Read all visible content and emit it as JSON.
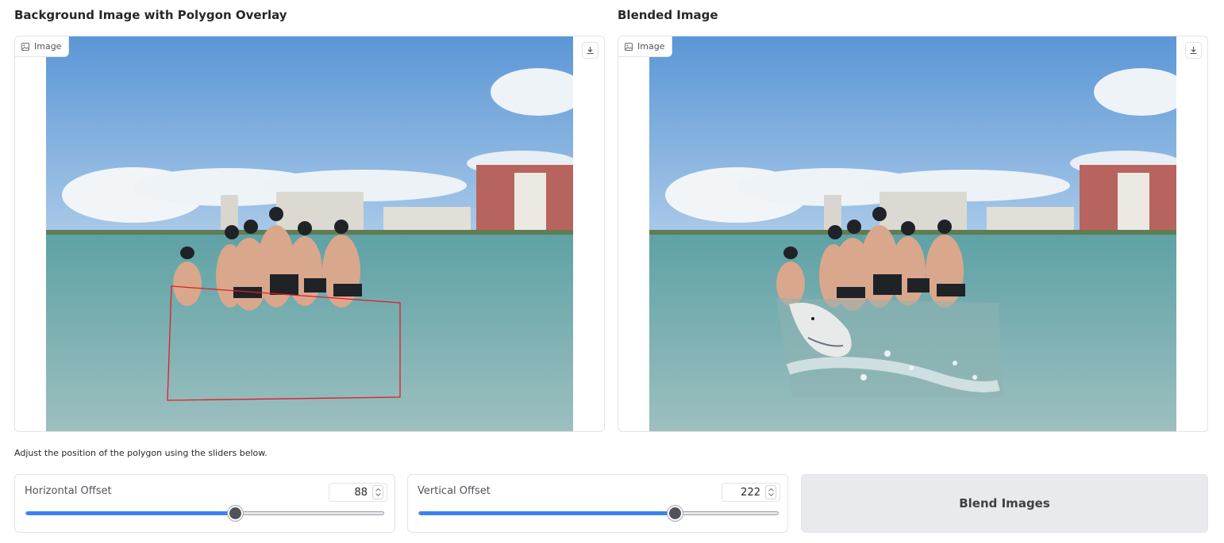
{
  "left_panel": {
    "title": "Background Image with Polygon Overlay",
    "image_label": "Image",
    "image_icon": "image-icon",
    "download_icon": "download-icon"
  },
  "right_panel": {
    "title": "Blended Image",
    "image_label": "Image",
    "image_icon": "image-icon",
    "download_icon": "download-icon"
  },
  "instructions": "Adjust the position of the polygon using the sliders below.",
  "horizontal_slider": {
    "label": "Horizontal Offset",
    "value": "88",
    "fraction": 0.585
  },
  "vertical_slider": {
    "label": "Vertical Offset",
    "value": "222",
    "fraction": 0.713
  },
  "blend_button": {
    "label": "Blend Images"
  },
  "colors": {
    "accent": "#3b82f6",
    "polygon_stroke": "#e11d24",
    "slider_thumb": "#52525b",
    "button_bg": "#e9eaee"
  }
}
